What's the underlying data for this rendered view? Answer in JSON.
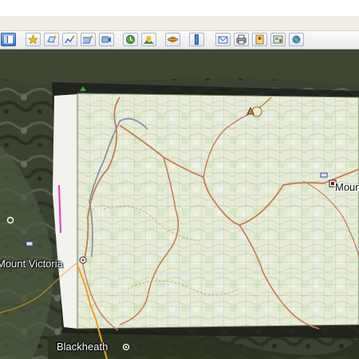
{
  "toolbar": {
    "buttons": [
      {
        "name": "sidebar-toggle-button",
        "icon": "sidebar-icon"
      },
      {
        "name": "add-placemark-button",
        "icon": "placemark-pin-icon"
      },
      {
        "name": "add-polygon-button",
        "icon": "polygon-icon"
      },
      {
        "name": "add-path-button",
        "icon": "path-icon"
      },
      {
        "name": "add-image-overlay-button",
        "icon": "image-overlay-icon"
      },
      {
        "name": "record-tour-button",
        "icon": "record-tour-icon"
      },
      {
        "name": "historical-imagery-button",
        "icon": "historical-imagery-icon"
      },
      {
        "name": "sunlight-button",
        "icon": "sunlight-icon"
      },
      {
        "name": "switch-to-sky-button",
        "icon": "planet-icon"
      },
      {
        "name": "ruler-button",
        "icon": "ruler-icon"
      },
      {
        "name": "email-button",
        "icon": "email-icon"
      },
      {
        "name": "print-button",
        "icon": "print-icon"
      },
      {
        "name": "save-image-button",
        "icon": "save-image-icon"
      },
      {
        "name": "view-in-maps-button",
        "icon": "maps-icon"
      },
      {
        "name": "earth-gallery-button",
        "icon": "gallery-icon"
      }
    ]
  },
  "map": {
    "places": {
      "mount_victoria": "Mount Victoria",
      "mount_partial": "Moun",
      "blackheath": "Blackheath"
    },
    "colors": {
      "satellite": "#3b4130",
      "topo_paper": "#eef0e2",
      "road": "#c97a55",
      "grid": "#6f9ad0",
      "highway": "#f0a020"
    }
  }
}
